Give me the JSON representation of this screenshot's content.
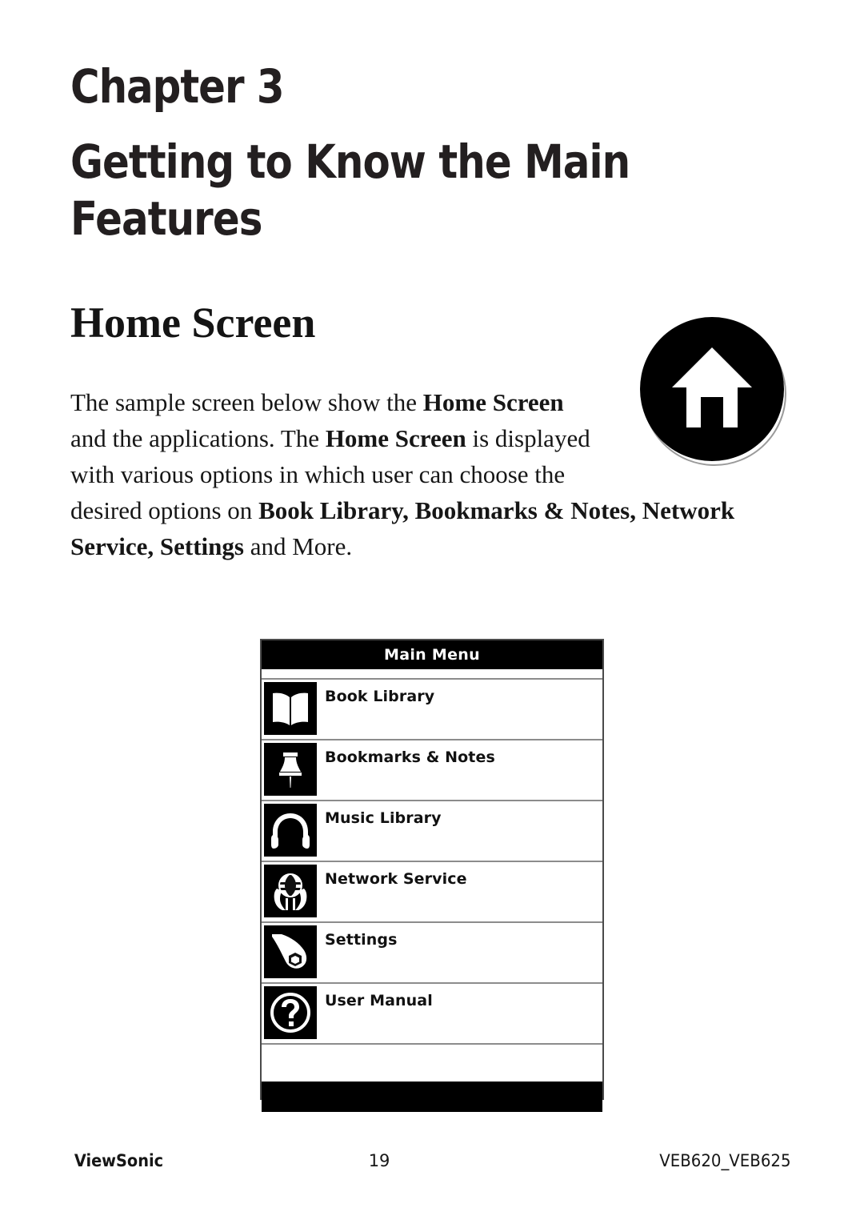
{
  "chapter": {
    "label": "Chapter 3",
    "title_line1": "Getting to Know the Main",
    "title_line2": "Features"
  },
  "section": {
    "heading": "Home Screen",
    "badge_icon": "home-icon"
  },
  "paragraph": {
    "line1_a": "The sample screen below show the ",
    "line1_b": "Home Screen",
    "line2_a": "and the applications. The ",
    "line2_b": "Home Screen",
    "line2_c": " is displayed",
    "line3": "with various options in which user can choose the",
    "line4_a": "desired options on ",
    "line4_b": "Book Library, Bookmarks & Notes, Network",
    "line5_a": "Service, Settings",
    "line5_b": " and More."
  },
  "device": {
    "title": "Main Menu",
    "items": [
      {
        "label": "Book Library",
        "icon": "open-book-icon"
      },
      {
        "label": "Bookmarks & Notes",
        "icon": "pushpin-icon"
      },
      {
        "label": "Music Library",
        "icon": "headphones-icon"
      },
      {
        "label": "Network Service",
        "icon": "globe-in-hands-icon"
      },
      {
        "label": "Settings",
        "icon": "wrench-icon"
      },
      {
        "label": "User Manual",
        "icon": "question-mark-icon"
      }
    ]
  },
  "footer": {
    "brand": "ViewSonic",
    "page_number": "19",
    "model": "VEB620_VEB625"
  },
  "colors": {
    "ink": "#1a1a1a",
    "heading_ink": "#231f20",
    "device_black": "#000000",
    "divider_gray": "#8c8c8c"
  }
}
